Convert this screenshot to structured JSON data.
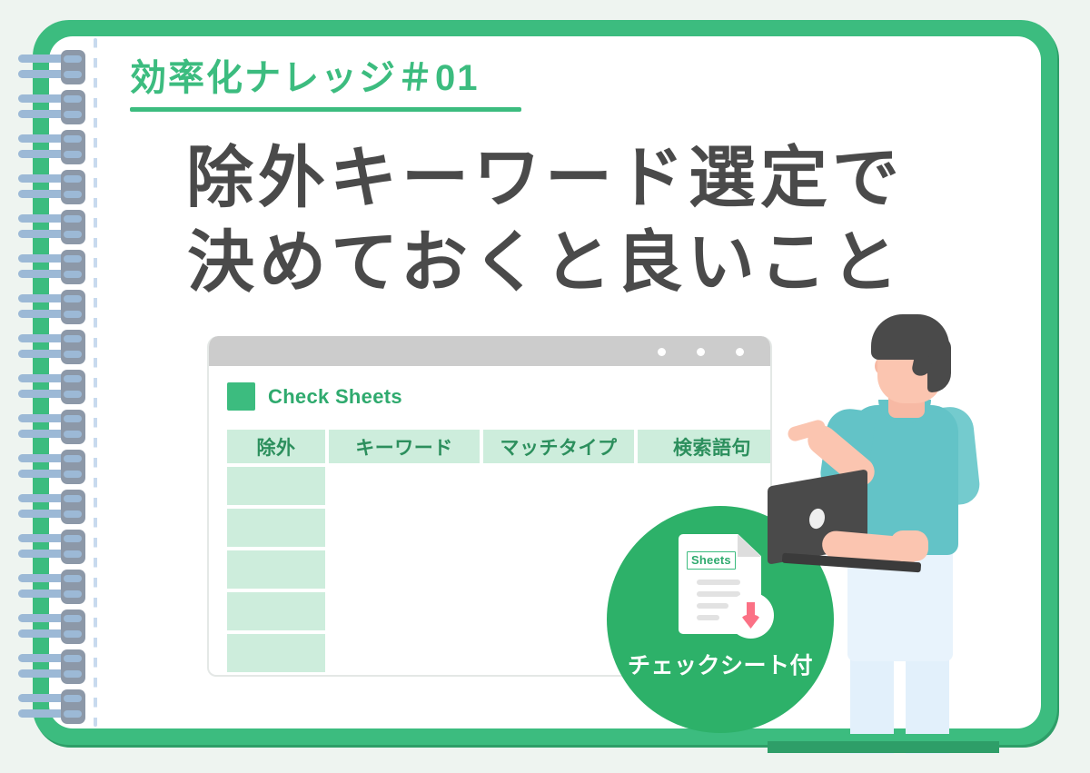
{
  "theme": {
    "background": "#eef4f0",
    "brand_green": "#3cbc7f",
    "brand_green_dark": "#2e9e68",
    "headline_gray": "#4a4a4a",
    "badge_green": "#2db169",
    "arrow_red": "#fb7185",
    "header_cell": "#cdeddc",
    "shirt_teal": "#63c3c7",
    "skin": "#fbc5b0",
    "pants": "#e8f3fc",
    "hair": "#4a4a4a",
    "ring_wire": "#9cb9d6",
    "ring_cap": "#8c98a8",
    "dotted_line": "#c8daee"
  },
  "eyebrow": {
    "text": "効率化ナレッジ＃01"
  },
  "headline": {
    "line1": "除外キーワード選定で",
    "line2": "決めておくと良いこと"
  },
  "window": {
    "dots": [
      "window-dot-1",
      "window-dot-2",
      "window-dot-3"
    ],
    "sheet_title": "Check Sheets",
    "swatch_icon": "green-square-icon"
  },
  "table": {
    "columns": [
      "除外",
      "キーワード",
      "マッチタイプ",
      "検索語句"
    ],
    "rows": [
      [
        "",
        "",
        "",
        ""
      ],
      [
        "",
        "",
        "",
        ""
      ],
      [
        "",
        "",
        "",
        ""
      ],
      [
        "",
        "",
        "",
        ""
      ],
      [
        "",
        "",
        "",
        ""
      ],
      [
        "",
        "",
        "",
        ""
      ]
    ]
  },
  "badge": {
    "doc_tag": "Sheets",
    "label": "チェックシート付",
    "download_icon": "download-arrow-icon"
  },
  "spiral": {
    "ring_count": 17
  }
}
